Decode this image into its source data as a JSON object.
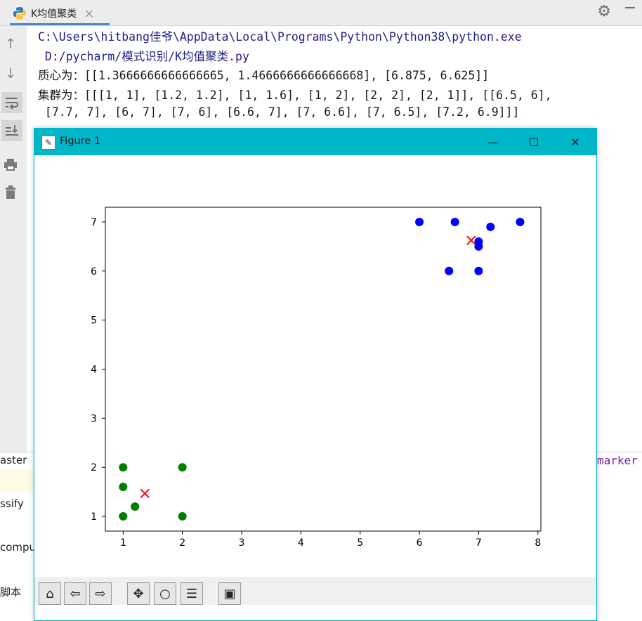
{
  "run_tab": {
    "title": "K均值聚类",
    "close_glyph": "×"
  },
  "console": {
    "lines": [
      "C:\\Users\\hitbang佳爷\\AppData\\Local\\Programs\\Python\\Python38\\python.exe",
      " D:/pycharm/模式识别/K均值聚类.py",
      "质心为：[[1.3666666666666665, 1.4666666666666668], [6.875, 6.625]]",
      "集群为：[[[1, 1], [1.2, 1.2], [1, 1.6], [1, 2], [2, 2], [2, 1]], [[6.5, 6],",
      " [7.7, 7], [6, 7], [7, 6], [6.6, 7], [7, 6.6], [7, 6.5], [7.2, 6.9]]]"
    ]
  },
  "editor_bg": {
    "left_fragments": [
      "aster",
      "ssify",
      "compu",
      "脚本"
    ],
    "right_fragment": "marker"
  },
  "figure": {
    "title": "Figure 1",
    "min_glyph": "—",
    "max_glyph": "☐",
    "close_glyph": "✕"
  },
  "chart_data": {
    "type": "scatter",
    "title": "",
    "xlabel": "",
    "ylabel": "",
    "xlim": [
      0.7,
      8.05
    ],
    "ylim": [
      0.7,
      7.3
    ],
    "xticks": [
      1,
      2,
      3,
      4,
      5,
      6,
      7,
      8
    ],
    "yticks": [
      1,
      2,
      3,
      4,
      5,
      6,
      7
    ],
    "grid": false,
    "series": [
      {
        "color": "#008000",
        "marker": "circle",
        "points": [
          [
            1,
            1
          ],
          [
            1.2,
            1.2
          ],
          [
            1,
            1.6
          ],
          [
            1,
            2
          ],
          [
            2,
            2
          ],
          [
            2,
            1
          ]
        ]
      },
      {
        "color": "#0000ff",
        "marker": "circle",
        "points": [
          [
            6.5,
            6
          ],
          [
            7.7,
            7
          ],
          [
            6,
            7
          ],
          [
            7,
            6
          ],
          [
            6.6,
            7
          ],
          [
            7,
            6.6
          ],
          [
            7,
            6.5
          ],
          [
            7.2,
            6.9
          ]
        ]
      },
      {
        "color": "#ff0000",
        "marker": "x",
        "points": [
          [
            1.3666666666666665,
            1.4666666666666668
          ],
          [
            6.875,
            6.625
          ]
        ]
      }
    ]
  }
}
